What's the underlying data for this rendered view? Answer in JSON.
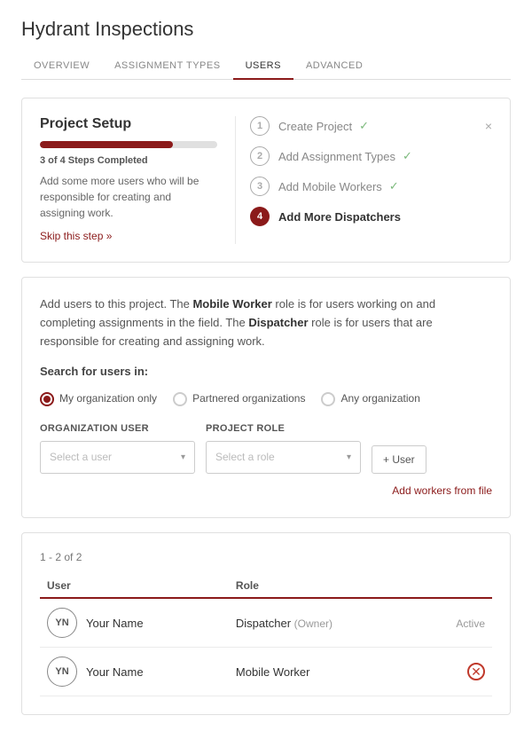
{
  "page": {
    "title": "Hydrant Inspections"
  },
  "nav": {
    "tabs": [
      {
        "id": "overview",
        "label": "OVERVIEW",
        "active": false
      },
      {
        "id": "assignment-types",
        "label": "ASSIGNMENT TYPES",
        "active": false
      },
      {
        "id": "users",
        "label": "USERS",
        "active": true
      },
      {
        "id": "advanced",
        "label": "ADVANCED",
        "active": false
      }
    ]
  },
  "project_setup": {
    "title": "Project Setup",
    "progress_pct": 75,
    "steps_completed": "3 of 4 Steps Completed",
    "description": "Add some more users who will be responsible for creating and assigning work.",
    "skip_label": "Skip this step »",
    "steps": [
      {
        "num": "1",
        "label": "Create Project",
        "status": "done",
        "check": true
      },
      {
        "num": "2",
        "label": "Add Assignment Types",
        "status": "done",
        "check": true
      },
      {
        "num": "3",
        "label": "Add Mobile Workers",
        "status": "done",
        "check": true
      },
      {
        "num": "4",
        "label": "Add More Dispatchers",
        "status": "current",
        "check": false
      }
    ],
    "close_icon": "×"
  },
  "search_section": {
    "description_part1": "Add users to this project. The ",
    "mobile_worker_bold": "Mobile Worker",
    "description_part2": " role is for users working on and completing assignments in the field. The ",
    "dispatcher_bold": "Dispatcher",
    "description_part3": " role is for users that are responsible for creating and assigning work.",
    "search_label": "Search for users in:",
    "radio_options": [
      {
        "id": "my-org",
        "label": "My organization only",
        "selected": true
      },
      {
        "id": "partnered",
        "label": "Partnered organizations",
        "selected": false
      },
      {
        "id": "any-org",
        "label": "Any organization",
        "selected": false
      }
    ],
    "user_label": "Organization User",
    "user_placeholder": "Select a user",
    "role_label": "Project Role",
    "role_placeholder": "Select a role",
    "add_user_label": "+ User",
    "add_workers_link": "Add workers from file"
  },
  "user_table": {
    "count_label": "1 - 2 of 2",
    "columns": [
      "User",
      "Role",
      ""
    ],
    "rows": [
      {
        "initials": "YN",
        "name": "Your Name",
        "role": "Dispatcher",
        "role_sub": "(Owner)",
        "status": "Active",
        "removable": false
      },
      {
        "initials": "YN",
        "name": "Your Name",
        "role": "Mobile Worker",
        "role_sub": "",
        "status": "",
        "removable": true
      }
    ]
  }
}
